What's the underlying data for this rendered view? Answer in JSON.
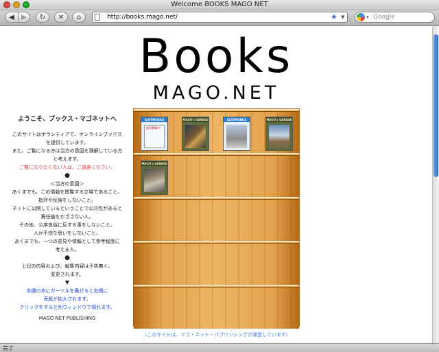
{
  "window": {
    "title": "Welcome BOOKS MAGO NET"
  },
  "toolbar": {
    "back_icon": "◀",
    "forward_icon": "▶",
    "reload_icon": "↻",
    "stop_icon": "✕",
    "home_icon": "⌂",
    "url": "http://books.mago.net/",
    "search_placeholder": "Google"
  },
  "logo": {
    "line1": "Books",
    "line2": "MAGO.NET"
  },
  "left": {
    "heading": "ようこそ、ブックス・マゴネットへ",
    "intro_lines": [
      "このサイトはボランティアで、オンラインブックス",
      "を提供しています。",
      "また、ご覧になる方は当方の意図を理解している方",
      "と考えます。"
    ],
    "warning": "ご覧になりたくない人は、ご遠慮ください。",
    "bullet": "●",
    "intent_title": "＜当方の意図＞",
    "intent_lines": [
      "あくまでも、この情報を閲覧する立場であること。",
      "批評や反論をしないこと。",
      "ネットに公開しているということで公共性があると",
      "責任論をかざさない人。",
      "その他、公序良俗に反する事をしないこと。",
      "人が不快な思いをしないこと。",
      "あくまでも、一つの意見や情報として参考程度に",
      "考える人。"
    ],
    "notice_lines": [
      "上記の内容および、編集内容は予告無く、",
      "変更されます。"
    ],
    "arrow": "▼",
    "instruction_lines": [
      "本棚の本にカーソルを乗せると右側に",
      "表紙が拡大されます。",
      "クリックをすると別ウィンドウで現れます。"
    ],
    "publisher": "MAGO NET PUBLISHING"
  },
  "books": [
    {
      "label": "SLOTMOBILE",
      "title": "創刊準備中！"
    },
    {
      "label": "MAGO's GARAGE",
      "title": ""
    },
    {
      "label": "SLOTMOBILE",
      "title": ""
    },
    {
      "label": "MAGO's GARAGE",
      "title": ""
    },
    {
      "label": "MAGO's GARAGE",
      "title": ""
    }
  ],
  "footer_note": "（このサイトは、マゴ・ネット・パブリッシングが運営しています）",
  "status": "完了"
}
